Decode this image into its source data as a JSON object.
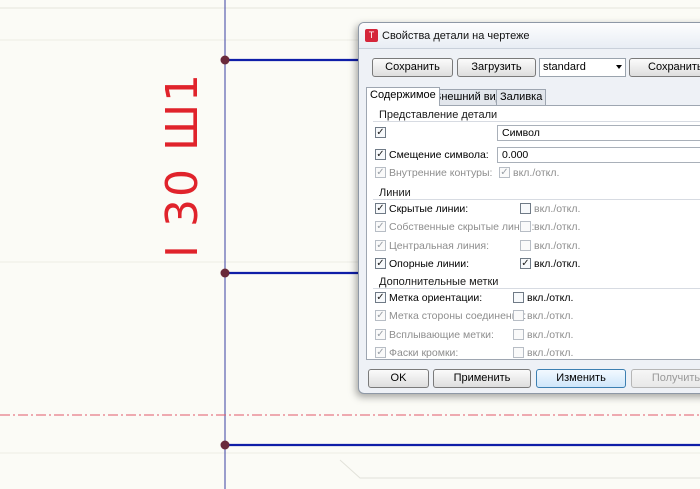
{
  "drawing": {
    "profile_label": "I 30 Ш1",
    "colors": {
      "beam": "#0f1ea8",
      "axis": "#5a5fb0",
      "centerline": "#e05a6a",
      "label": "#e0232b",
      "node": "#6a2a3a"
    }
  },
  "dialog": {
    "title": "Свойства детали на чертеже",
    "app_icon": "tekla-icon",
    "top_buttons": {
      "save": "Сохранить",
      "load": "Загрузить",
      "save_as": "Сохранить ка"
    },
    "preset": {
      "selected": "standard"
    },
    "tabs": [
      "Содержимое",
      "Внешний вид",
      "Заливка"
    ],
    "active_tab": "Содержимое",
    "groups": {
      "part_representation": {
        "title": "Представление детали",
        "rows": [
          {
            "label": "",
            "checked": true,
            "enabled": true,
            "value": "Символ"
          },
          {
            "label": "Смещение символа:",
            "checked": true,
            "enabled": true,
            "value": "0.000"
          },
          {
            "label": "Внутренние контуры:",
            "checked": true,
            "enabled": false,
            "toggle_label": "вкл./откл.",
            "toggle_checked": true
          }
        ]
      },
      "lines": {
        "title": "Линии",
        "rows": [
          {
            "label": "Скрытые линии:",
            "checked": true,
            "enabled": true,
            "toggle_label": "вкл./откл.",
            "toggle_checked": false
          },
          {
            "label": "Собственные скрытые линии:",
            "checked": true,
            "enabled": false,
            "toggle_label": "вкл./откл.",
            "toggle_checked": false
          },
          {
            "label": "Центральная линия:",
            "checked": true,
            "enabled": false,
            "toggle_label": "вкл./откл.",
            "toggle_checked": false
          },
          {
            "label": "Опорные линии:",
            "checked": true,
            "enabled": true,
            "toggle_label": "вкл./откл.",
            "toggle_checked": true
          }
        ]
      },
      "extra_marks": {
        "title": "Дополнительные метки",
        "rows": [
          {
            "label": "Метка ориентации:",
            "checked": true,
            "enabled": true,
            "toggle_label": "вкл./откл.",
            "toggle_checked": false
          },
          {
            "label": "Метка стороны соединения:",
            "checked": true,
            "enabled": false,
            "toggle_label": "вкл./откл.",
            "toggle_checked": false
          },
          {
            "label": "Всплывающие метки:",
            "checked": true,
            "enabled": false,
            "toggle_label": "вкл./откл.",
            "toggle_checked": false
          },
          {
            "label": "Фаски кромки:",
            "checked": true,
            "enabled": false,
            "toggle_label": "вкл./откл.",
            "toggle_checked": false
          }
        ]
      }
    },
    "bottom_buttons": {
      "ok": "OK",
      "apply": "Применить",
      "modify": "Изменить",
      "get": "Получить"
    },
    "check_glyph": "✓"
  }
}
